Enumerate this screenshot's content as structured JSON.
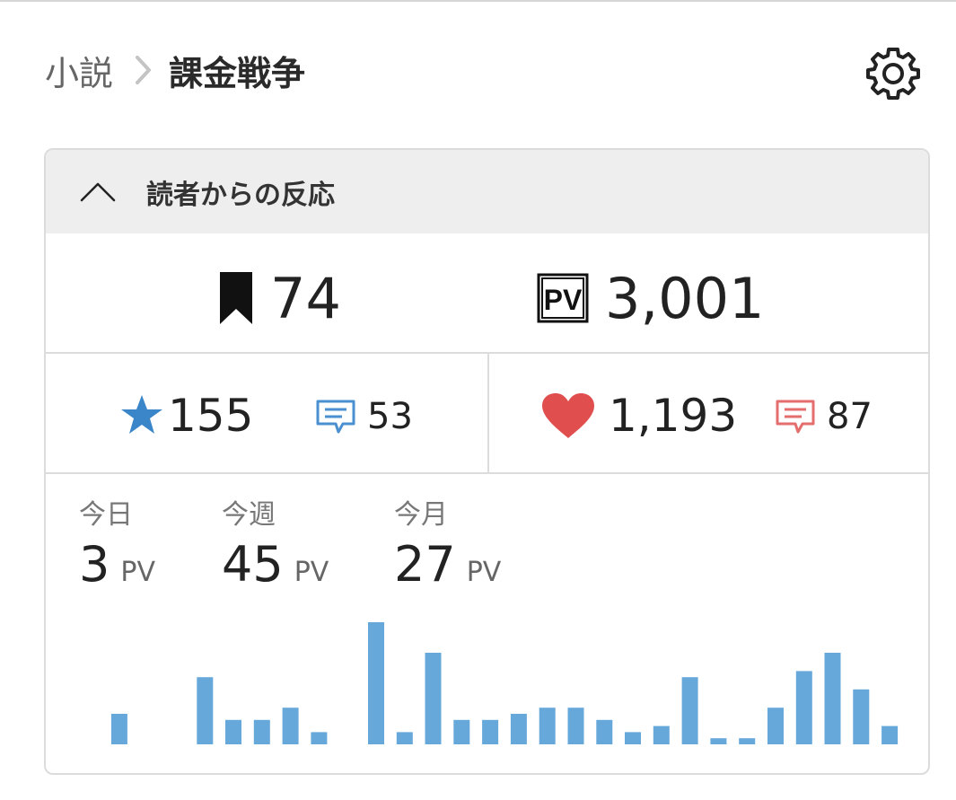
{
  "breadcrumb": {
    "parent": "小説",
    "current": "課金戦争"
  },
  "panel": {
    "title": "読者からの反応"
  },
  "stats": {
    "bookmarks": "74",
    "pv_icon_text": "PV",
    "page_views": "3,001",
    "stars": "155",
    "star_comments": "53",
    "hearts": "1,193",
    "heart_comments": "87"
  },
  "periods": [
    {
      "label": "今日",
      "value": "3",
      "unit": "PV"
    },
    {
      "label": "今週",
      "value": "45",
      "unit": "PV"
    },
    {
      "label": "今月",
      "value": "27",
      "unit": "PV"
    }
  ],
  "colors": {
    "star": "#3b86c9",
    "heart": "#e04e4e",
    "comment_blue": "#4a90d0",
    "comment_red": "#e46d6d",
    "bar": "#67a8db"
  },
  "chart_data": {
    "type": "bar",
    "values": [
      5,
      0,
      0,
      11,
      4,
      4,
      6,
      2,
      0,
      20,
      2,
      15,
      4,
      4,
      5,
      6,
      6,
      4,
      2,
      3,
      11,
      1,
      1,
      6,
      12,
      15,
      9,
      3
    ],
    "ylim": [
      0,
      20
    ],
    "grid": false,
    "legend": "none"
  }
}
